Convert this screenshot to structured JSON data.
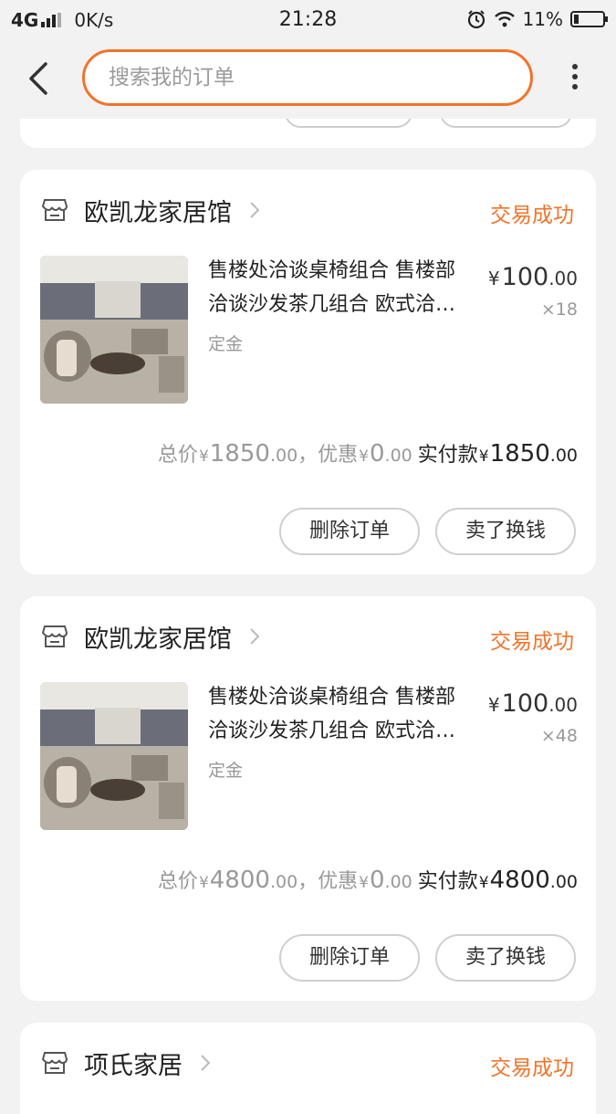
{
  "status_bar": {
    "network": "4G",
    "speed": "0K/s",
    "time": "21:28",
    "battery": "11%",
    "icons": [
      "signal-icon",
      "alarm-icon",
      "wifi-icon",
      "battery-icon"
    ]
  },
  "header": {
    "search_placeholder": "搜索我的订单",
    "accent_color": "#f0742a"
  },
  "orders": [
    {
      "store": "欧凯龙家居馆",
      "status": "交易成功",
      "title": "售楼处洽谈桌椅组合 售楼部洽谈沙发茶几组合 欧式洽谈桌椅组合",
      "spec": "定金",
      "price_int": "100",
      "price_dec": ".00",
      "quantity": "×18",
      "total_label": "总价",
      "total_int": "1850",
      "total_dec": ".00",
      "discount_label": "，优惠",
      "discount_int": "0",
      "discount_dec": ".00",
      "paid_label": "实付款",
      "paid_int": "1850",
      "paid_dec": ".00",
      "actions": [
        "删除订单",
        "卖了换钱"
      ]
    },
    {
      "store": "欧凯龙家居馆",
      "status": "交易成功",
      "title": "售楼处洽谈桌椅组合 售楼部洽谈沙发茶几组合 欧式洽谈桌椅组合",
      "spec": "定金",
      "price_int": "100",
      "price_dec": ".00",
      "quantity": "×48",
      "total_label": "总价",
      "total_int": "4800",
      "total_dec": ".00",
      "discount_label": "，优惠",
      "discount_int": "0",
      "discount_dec": ".00",
      "paid_label": "实付款",
      "paid_int": "4800",
      "paid_dec": ".00",
      "actions": [
        "删除订单",
        "卖了换钱"
      ]
    },
    {
      "store": "项氏家居",
      "status": "交易成功"
    }
  ],
  "currency_symbol": "¥"
}
